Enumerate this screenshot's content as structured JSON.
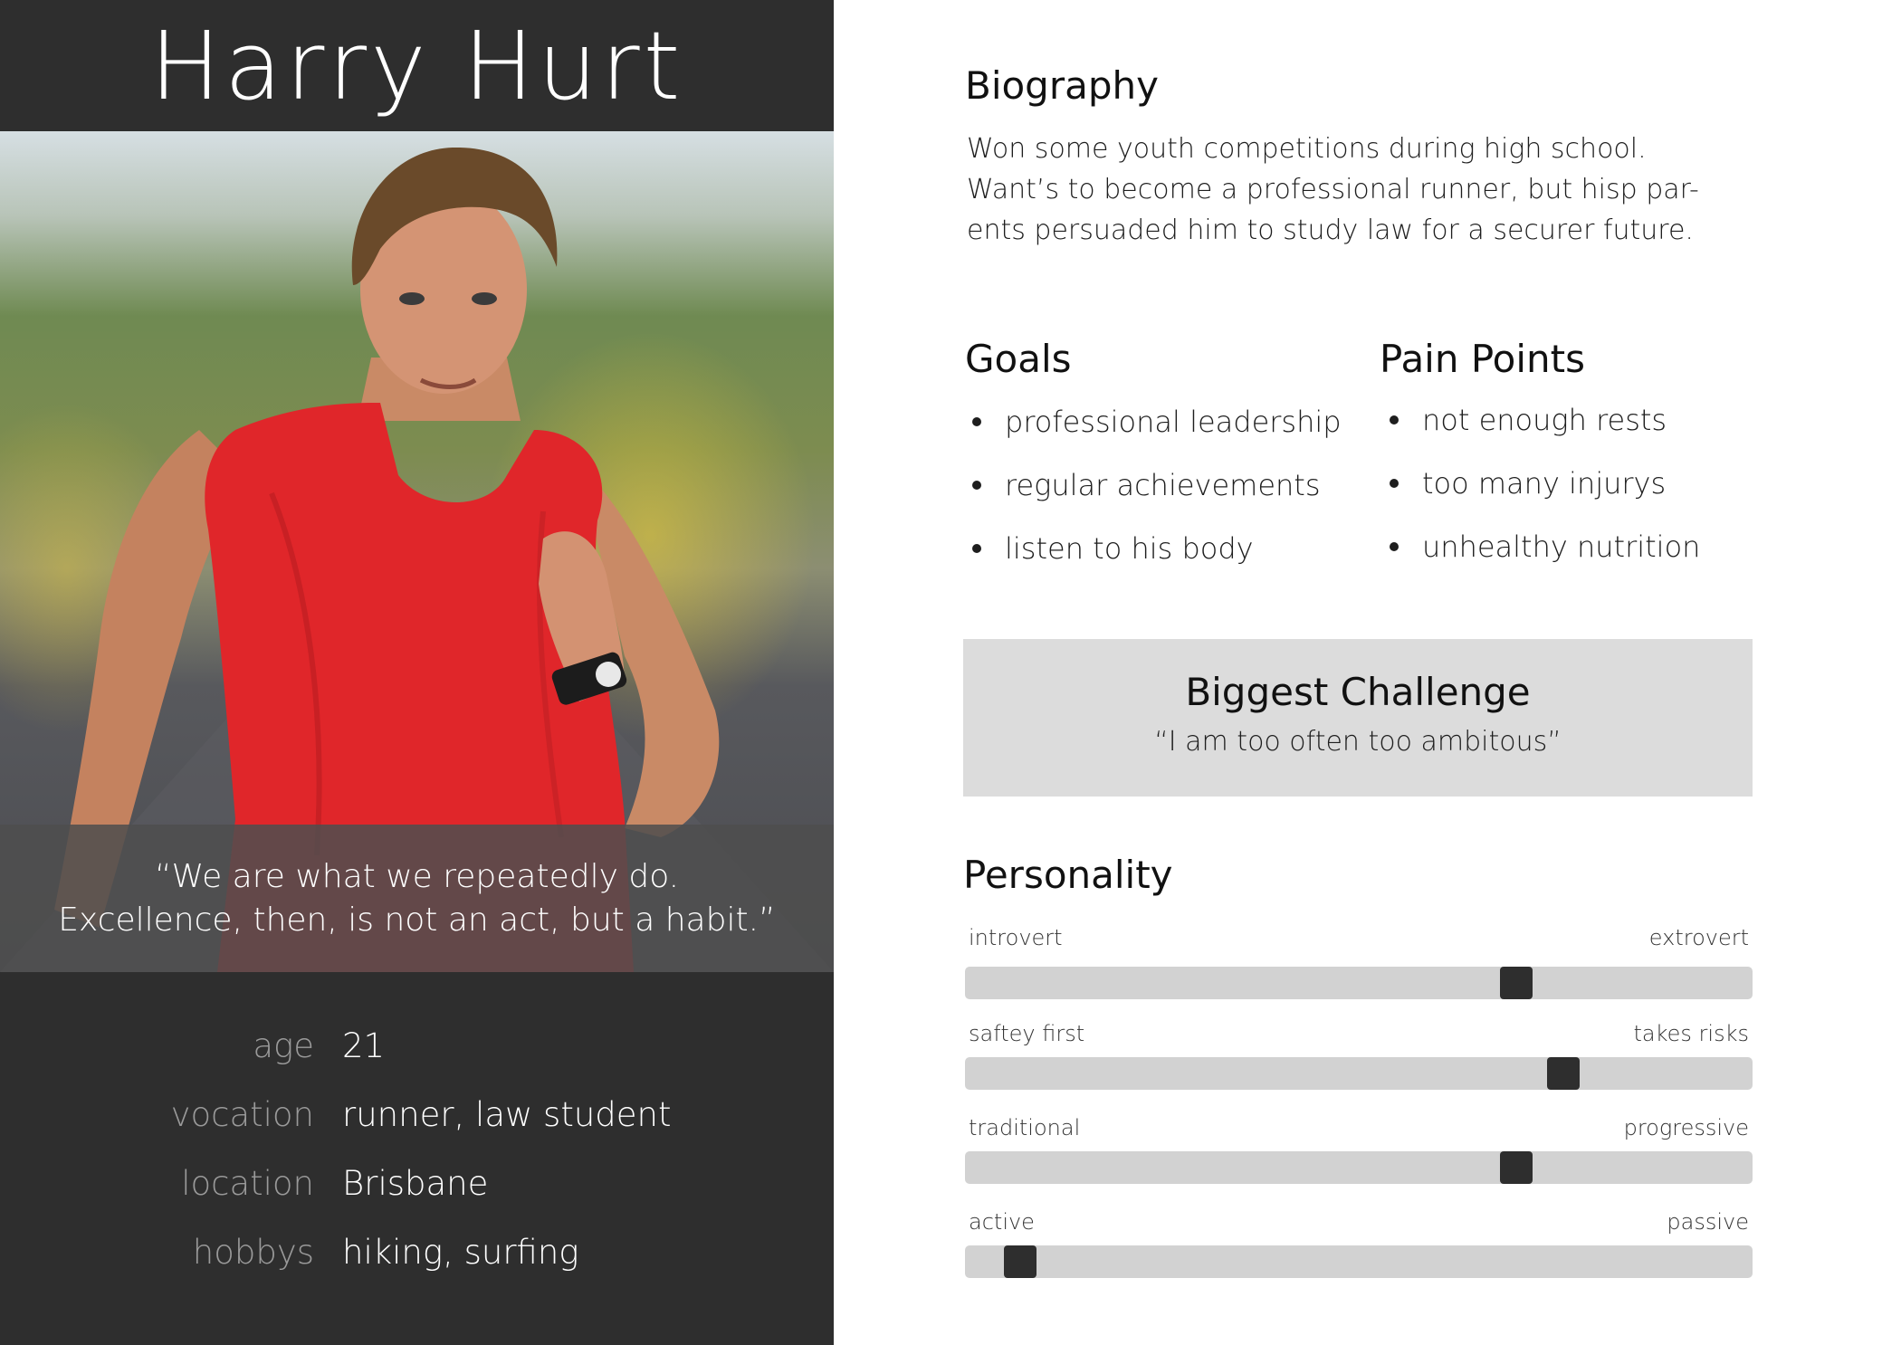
{
  "persona": {
    "name": "Harry Hurt",
    "quote_line1": "“We are what we repeatedly do.",
    "quote_line2": "Excellence, then, is not an act, but a habit.”",
    "facts": [
      {
        "label": "age",
        "value": "21"
      },
      {
        "label": "vocation",
        "value": "runner, law student"
      },
      {
        "label": "location",
        "value": "Brisbane"
      },
      {
        "label": "hobbys",
        "value": "hiking, surfing"
      }
    ]
  },
  "biography": {
    "heading": "Biography",
    "lines": [
      "Won some youth competitions during high school.",
      "Want’s to become a professional runner, but hisp par-",
      "ents persuaded him to study law for a securer future."
    ]
  },
  "goals": {
    "heading": "Goals",
    "items": [
      "professional leadership",
      "regular achievements",
      "listen to his body"
    ]
  },
  "pain_points": {
    "heading": "Pain Points",
    "items": [
      "not enough rests",
      "too many injurys",
      "unhealthy nutrition"
    ]
  },
  "challenge": {
    "heading": "Biggest Challenge",
    "quote": "“I am too often too ambitous”"
  },
  "personality": {
    "heading": "Personality",
    "sliders": [
      {
        "left": "introvert",
        "right": "extrovert",
        "value": 0.7
      },
      {
        "left": "saftey first",
        "right": "takes risks",
        "value": 0.76
      },
      {
        "left": "traditional",
        "right": "progressive",
        "value": 0.7
      },
      {
        "left": "active",
        "right": "passive",
        "value": 0.07
      }
    ]
  },
  "colors": {
    "dark_panel": "#2e2e2e",
    "slider_track": "#d2d2d2",
    "slider_thumb": "#2e2e2e",
    "challenge_bg": "#dcdcdc",
    "shirt": "#e0262a"
  }
}
